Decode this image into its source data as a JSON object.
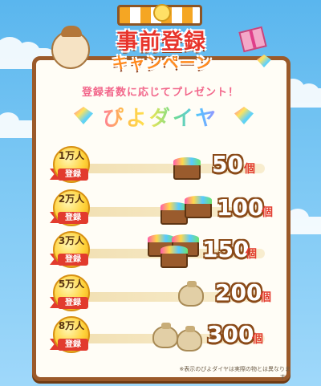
{
  "header": {
    "title_line1": "事前登録",
    "title_line2": "キャンペーン"
  },
  "intro": {
    "subtitle": "登録者数に応じてプレゼント！",
    "gift_name": "ぴよダイヤ"
  },
  "milestones": [
    {
      "count": "1万人",
      "label": "登録",
      "amount": "50",
      "unit": "個",
      "reward_icon": "treasure-chest-small-icon"
    },
    {
      "count": "2万人",
      "label": "登録",
      "amount": "100",
      "unit": "個",
      "reward_icon": "treasure-chest-pair-icon"
    },
    {
      "count": "3万人",
      "label": "登録",
      "amount": "150",
      "unit": "個",
      "reward_icon": "treasure-chest-trio-icon"
    },
    {
      "count": "5万人",
      "label": "登録",
      "amount": "200",
      "unit": "個",
      "reward_icon": "gem-bag-icon"
    },
    {
      "count": "8万人",
      "label": "登録",
      "amount": "300",
      "unit": "個",
      "reward_icon": "gem-bags-pair-icon"
    }
  ],
  "footnote": "※表示のぴよダイヤは実際の物とは異なります。",
  "colors": {
    "frame": "#9b5a2a",
    "ribbon": "#e23b2e",
    "medal": "#ffd23a",
    "sky": "#5ab6ee"
  }
}
